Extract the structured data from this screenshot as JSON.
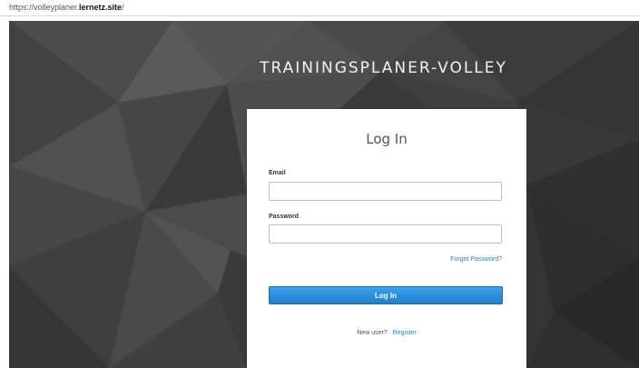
{
  "browser": {
    "url_prefix": "https://volleyplaner.",
    "url_domain": "lernetz.site",
    "url_suffix": "/"
  },
  "page": {
    "brand_title": "TRAININGSPLANER-VOLLEY",
    "background_color": "#3a3a3a"
  },
  "login": {
    "title": "Log In",
    "email_label": "Email",
    "email_value": "",
    "password_label": "Password",
    "password_value": "",
    "forgot_password_label": "Forgot Password?",
    "submit_label": "Log In",
    "new_user_text": "New user?",
    "register_label": "Register",
    "accent_color": "#2a7fc8"
  }
}
